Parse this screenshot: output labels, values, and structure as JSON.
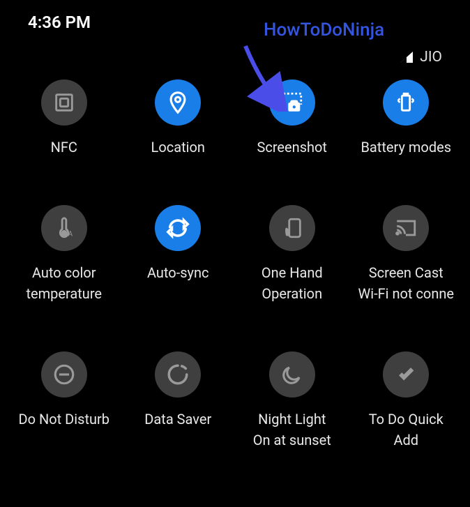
{
  "status": {
    "time": "4:36 PM",
    "carrier": "JIO"
  },
  "watermark": "HowToDoNinja",
  "tiles": [
    {
      "label": "NFC",
      "sublabel": "",
      "active": false
    },
    {
      "label": "Location",
      "sublabel": "",
      "active": true
    },
    {
      "label": "Screenshot",
      "sublabel": "",
      "active": true
    },
    {
      "label": "Battery modes",
      "sublabel": "",
      "active": true
    },
    {
      "label": "Auto color",
      "sublabel": "temperature",
      "active": false
    },
    {
      "label": "Auto-sync",
      "sublabel": "",
      "active": true
    },
    {
      "label": "One Hand",
      "sublabel": "Operation",
      "active": false
    },
    {
      "label": "Screen Cast",
      "sublabel": "Wi-Fi not conne",
      "active": false
    },
    {
      "label": "Do Not Disturb",
      "sublabel": "",
      "active": false
    },
    {
      "label": "Data Saver",
      "sublabel": "",
      "active": false
    },
    {
      "label": "Night Light",
      "sublabel": "On at sunset",
      "active": false
    },
    {
      "label": "To Do Quick",
      "sublabel": "Add",
      "active": false
    }
  ]
}
